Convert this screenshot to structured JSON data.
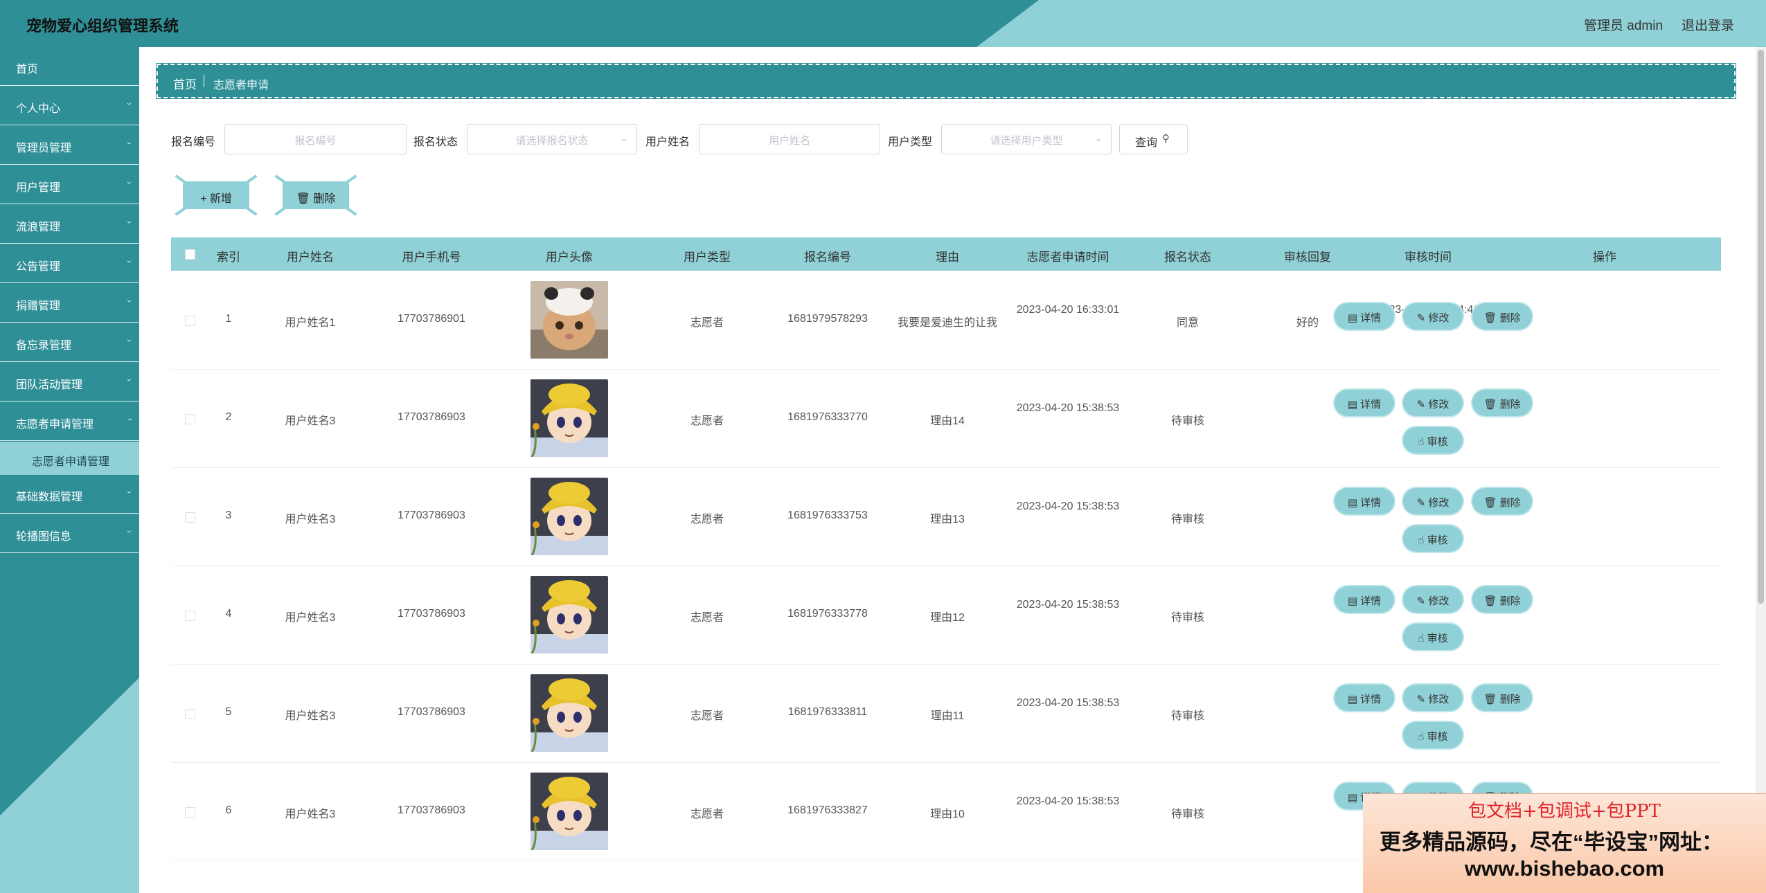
{
  "header": {
    "title": "宠物爱心组织管理系统",
    "admin_label": "管理员 admin",
    "logout_label": "退出登录"
  },
  "sidebar": {
    "items": [
      {
        "label": "首页"
      },
      {
        "label": "个人中心"
      },
      {
        "label": "管理员管理"
      },
      {
        "label": "用户管理"
      },
      {
        "label": "流浪管理"
      },
      {
        "label": "公告管理"
      },
      {
        "label": "捐赠管理"
      },
      {
        "label": "备忘录管理"
      },
      {
        "label": "团队活动管理"
      },
      {
        "label": "志愿者申请管理"
      },
      {
        "label": "基础数据管理"
      },
      {
        "label": "轮播图信息"
      }
    ],
    "sub_item": "志愿者申请管理"
  },
  "breadcrumb": {
    "home": "首页",
    "current": "志愿者申请"
  },
  "search": {
    "f1_label": "报名编号",
    "f1_placeholder": "报名编号",
    "f2_label": "报名状态",
    "f2_placeholder": "请选择报名状态",
    "f3_label": "用户姓名",
    "f3_placeholder": "用户姓名",
    "f4_label": "用户类型",
    "f4_placeholder": "请选择用户类型",
    "query_label": "查询"
  },
  "toolbar": {
    "add_label": "+ 新增",
    "delete_label": "删除"
  },
  "table": {
    "columns": [
      "索引",
      "用户姓名",
      "用户手机号",
      "用户头像",
      "用户类型",
      "报名编号",
      "理由",
      "志愿者申请时间",
      "报名状态",
      "审核回复",
      "审核时间",
      "操作"
    ],
    "rows": [
      {
        "index": "1",
        "name": "用户姓名1",
        "phone": "17703786901",
        "type": "志愿者",
        "code": "1681979578293",
        "reason": "我要是爱迪生的让我",
        "apply_time": "2023-04-20 16:33:01",
        "status": "同意",
        "reply": "好的",
        "review_time": "2023-04-20 16:34:46"
      },
      {
        "index": "2",
        "name": "用户姓名3",
        "phone": "17703786903",
        "type": "志愿者",
        "code": "1681976333770",
        "reason": "理由14",
        "apply_time": "2023-04-20 15:38:53",
        "status": "待审核",
        "reply": "",
        "review_time": ""
      },
      {
        "index": "3",
        "name": "用户姓名3",
        "phone": "17703786903",
        "type": "志愿者",
        "code": "1681976333753",
        "reason": "理由13",
        "apply_time": "2023-04-20 15:38:53",
        "status": "待审核",
        "reply": "",
        "review_time": ""
      },
      {
        "index": "4",
        "name": "用户姓名3",
        "phone": "17703786903",
        "type": "志愿者",
        "code": "1681976333778",
        "reason": "理由12",
        "apply_time": "2023-04-20 15:38:53",
        "status": "待审核",
        "reply": "",
        "review_time": ""
      },
      {
        "index": "5",
        "name": "用户姓名3",
        "phone": "17703786903",
        "type": "志愿者",
        "code": "1681976333811",
        "reason": "理由11",
        "apply_time": "2023-04-20 15:38:53",
        "status": "待审核",
        "reply": "",
        "review_time": ""
      },
      {
        "index": "6",
        "name": "用户姓名3",
        "phone": "17703786903",
        "type": "志愿者",
        "code": "1681976333827",
        "reason": "理由10",
        "apply_time": "2023-04-20 15:38:53",
        "status": "待审核",
        "reply": "",
        "review_time": ""
      }
    ],
    "actions": {
      "detail": "详情",
      "edit": "修改",
      "delete": "删除",
      "review": "审核"
    }
  },
  "watermark": {
    "line1": "包文档+包调试+包PPT",
    "line2": "更多精品源码，尽在“毕设宝”网址：",
    "line3": "www.bishebao.com"
  },
  "colors": {
    "primary": "#2f8f97",
    "accent_light": "#8fd1d7"
  }
}
